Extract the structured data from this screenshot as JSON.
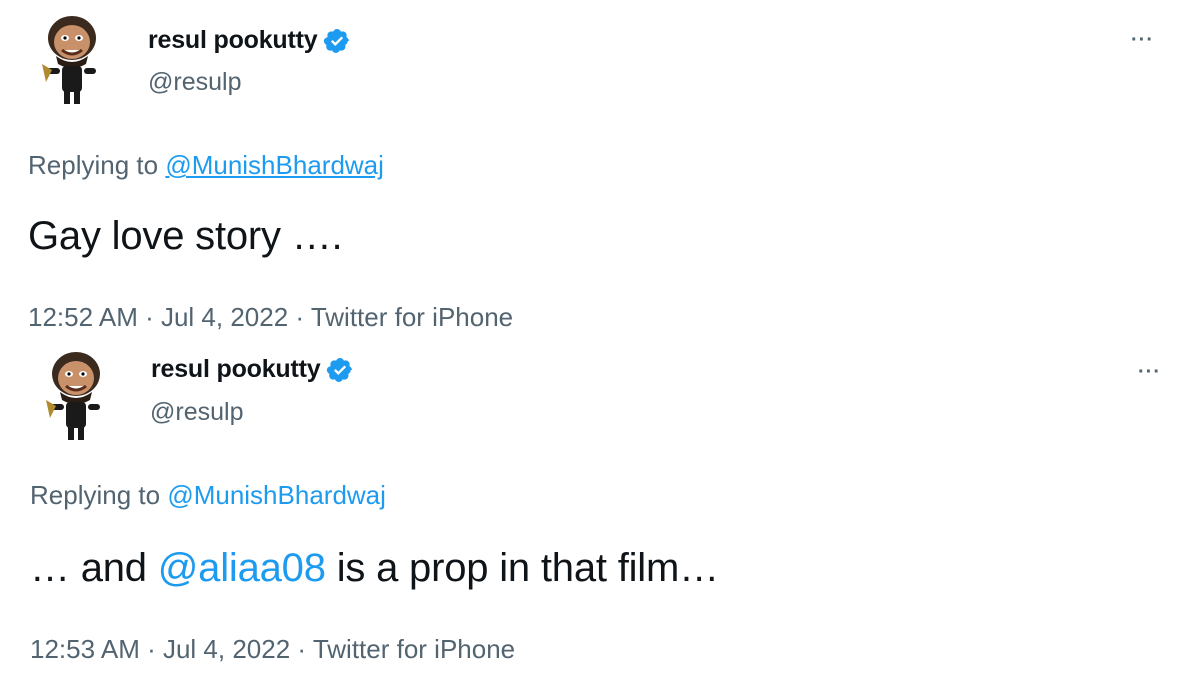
{
  "colors": {
    "accent": "#1d9bf0",
    "muted": "#536471",
    "text": "#0f1419"
  },
  "tweets": [
    {
      "display_name": "resul pookutty",
      "handle": "@resulp",
      "more_label": "···",
      "replying_prefix": "Replying to",
      "replying_to": "@MunishBhardwaj",
      "body_before": "Gay love story ….",
      "body_mention": "",
      "body_after": "",
      "time": "12:52 AM",
      "date": "Jul 4, 2022",
      "source": "Twitter for iPhone",
      "avatar_icon": "caricature-avatar-icon",
      "verified_icon": "verified-badge-icon"
    },
    {
      "display_name": "resul pookutty",
      "handle": "@resulp",
      "more_label": "···",
      "replying_prefix": "Replying to",
      "replying_to": "@MunishBhardwaj",
      "body_before": "… and ",
      "body_mention": "@aliaa08",
      "body_after": " is a prop in that film…",
      "time": "12:53 AM",
      "date": "Jul 4, 2022",
      "source": "Twitter for iPhone",
      "avatar_icon": "caricature-avatar-icon",
      "verified_icon": "verified-badge-icon"
    }
  ]
}
